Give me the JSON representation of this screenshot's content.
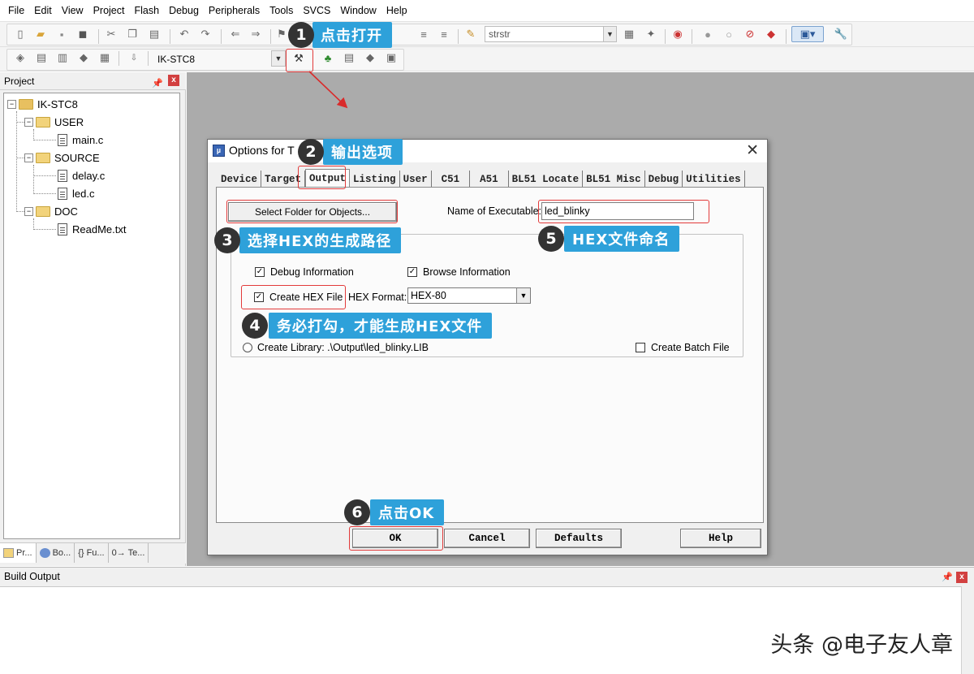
{
  "menu": [
    "File",
    "Edit",
    "View",
    "Project",
    "Flash",
    "Debug",
    "Peripherals",
    "Tools",
    "SVCS",
    "Window",
    "Help"
  ],
  "toolbar": {
    "find_combo": "strstr",
    "target_combo": "IK-STC8"
  },
  "project_panel": {
    "title": "Project",
    "root": "IK-STC8",
    "groups": [
      {
        "name": "USER",
        "files": [
          "main.c"
        ]
      },
      {
        "name": "SOURCE",
        "files": [
          "delay.c",
          "led.c"
        ]
      },
      {
        "name": "DOC",
        "files": [
          "ReadMe.txt"
        ]
      }
    ],
    "bottom_tabs": [
      "Pr...",
      "Bo...",
      "{} Fu...",
      "0→ Te..."
    ]
  },
  "build_output": {
    "title": "Build Output"
  },
  "dialog": {
    "title": "Options for T",
    "tabs": [
      "Device",
      "Target",
      "Output",
      "Listing",
      "User",
      "C51",
      "A51",
      "BL51 Locate",
      "BL51 Misc",
      "Debug",
      "Utilities"
    ],
    "active_tab": "Output",
    "select_folder_btn": "Select Folder for Objects...",
    "name_exe_label": "Name of Executable:",
    "name_exe_value": "led_blinky",
    "debug_info_label": "Debug Information",
    "browse_info_label": "Browse Information",
    "create_hex_label": "Create HEX File",
    "hex_format_label": "HEX Format:",
    "hex_format_value": "HEX-80",
    "create_library_label": "Create Library:  .\\Output\\led_blinky.LIB",
    "create_batch_label": "Create Batch File",
    "checks": {
      "debug_info": true,
      "browse_info": true,
      "create_hex": true,
      "create_batch": false
    },
    "buttons": {
      "ok": "OK",
      "cancel": "Cancel",
      "defaults": "Defaults",
      "help": "Help"
    }
  },
  "callouts": [
    {
      "num": "1",
      "text": "点击打开"
    },
    {
      "num": "2",
      "text": "输出选项"
    },
    {
      "num": "3",
      "text": "选择HEX的生成路径"
    },
    {
      "num": "4",
      "text": "务必打勾，才能生成HEX文件"
    },
    {
      "num": "5",
      "text": "HEX文件命名"
    },
    {
      "num": "6",
      "text": "点击OK"
    }
  ],
  "watermark": "头条 @电子友人章",
  "colors": {
    "callout": "#2ea1da",
    "highlight": "#e23a3a",
    "workspace": "#ababab"
  }
}
